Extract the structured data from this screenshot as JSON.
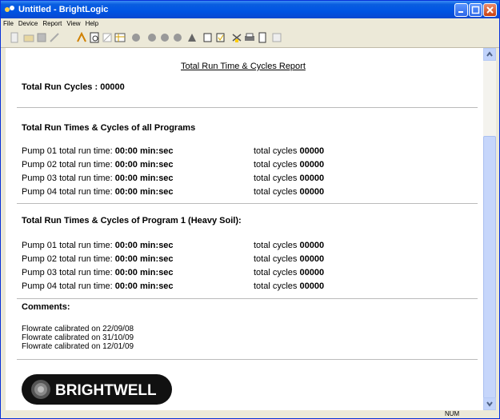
{
  "window": {
    "title": "Untitled - BrightLogic"
  },
  "menu": [
    "File",
    "Device",
    "Report",
    "View",
    "Help"
  ],
  "toolbar_icons": [
    "new-icon",
    "open-icon",
    "save-icon",
    "tool-icon",
    "connect-icon",
    "preview-icon",
    "edit-icon",
    "grid-icon",
    "pump-icon",
    "pump2-icon",
    "pump3-icon",
    "pump4-icon",
    "doc-icon",
    "copy-icon",
    "check-icon",
    "print-icon",
    "page-icon",
    "help-icon"
  ],
  "report": {
    "title": "Total Run Time & Cycles Report",
    "total_cycles_label": "Total Run Cycles : 00000",
    "section_all": "Total Run Times & Cycles of all Programs",
    "section_prog1": "Total Run Times & Cycles of Program 1 (Heavy Soil):",
    "all_programs": [
      {
        "label": "Pump 01 total run time: ",
        "time": "00:00 min:sec",
        "cycles_label": "total cycles ",
        "cycles": "00000"
      },
      {
        "label": "Pump 02 total run time: ",
        "time": "00:00 min:sec",
        "cycles_label": "total cycles ",
        "cycles": "00000"
      },
      {
        "label": "Pump 03 total run time: ",
        "time": "00:00 min:sec",
        "cycles_label": "total cycles ",
        "cycles": "00000"
      },
      {
        "label": "Pump 04 total run time: ",
        "time": "00:00 min:sec",
        "cycles_label": "total cycles ",
        "cycles": "00000"
      }
    ],
    "program1": [
      {
        "label": "Pump 01 total run time: ",
        "time": "00:00 min:sec",
        "cycles_label": "total cycles ",
        "cycles": "00000"
      },
      {
        "label": "Pump 02 total run time: ",
        "time": "00:00 min:sec",
        "cycles_label": "total cycles ",
        "cycles": "00000"
      },
      {
        "label": "Pump 03 total run time: ",
        "time": "00:00 min:sec",
        "cycles_label": "total cycles ",
        "cycles": "00000"
      },
      {
        "label": "Pump 04 total run time: ",
        "time": "00:00 min:sec",
        "cycles_label": "total cycles ",
        "cycles": "00000"
      }
    ],
    "comments_label": "Comments:",
    "comments": [
      "Flowrate calibrated on 22/09/08",
      "Flowrate calibrated on 31/10/09",
      "Flowrate calibrated on 12/01/09"
    ],
    "logo_text": "BRIGHTWELL"
  },
  "status": {
    "num": "NUM"
  }
}
